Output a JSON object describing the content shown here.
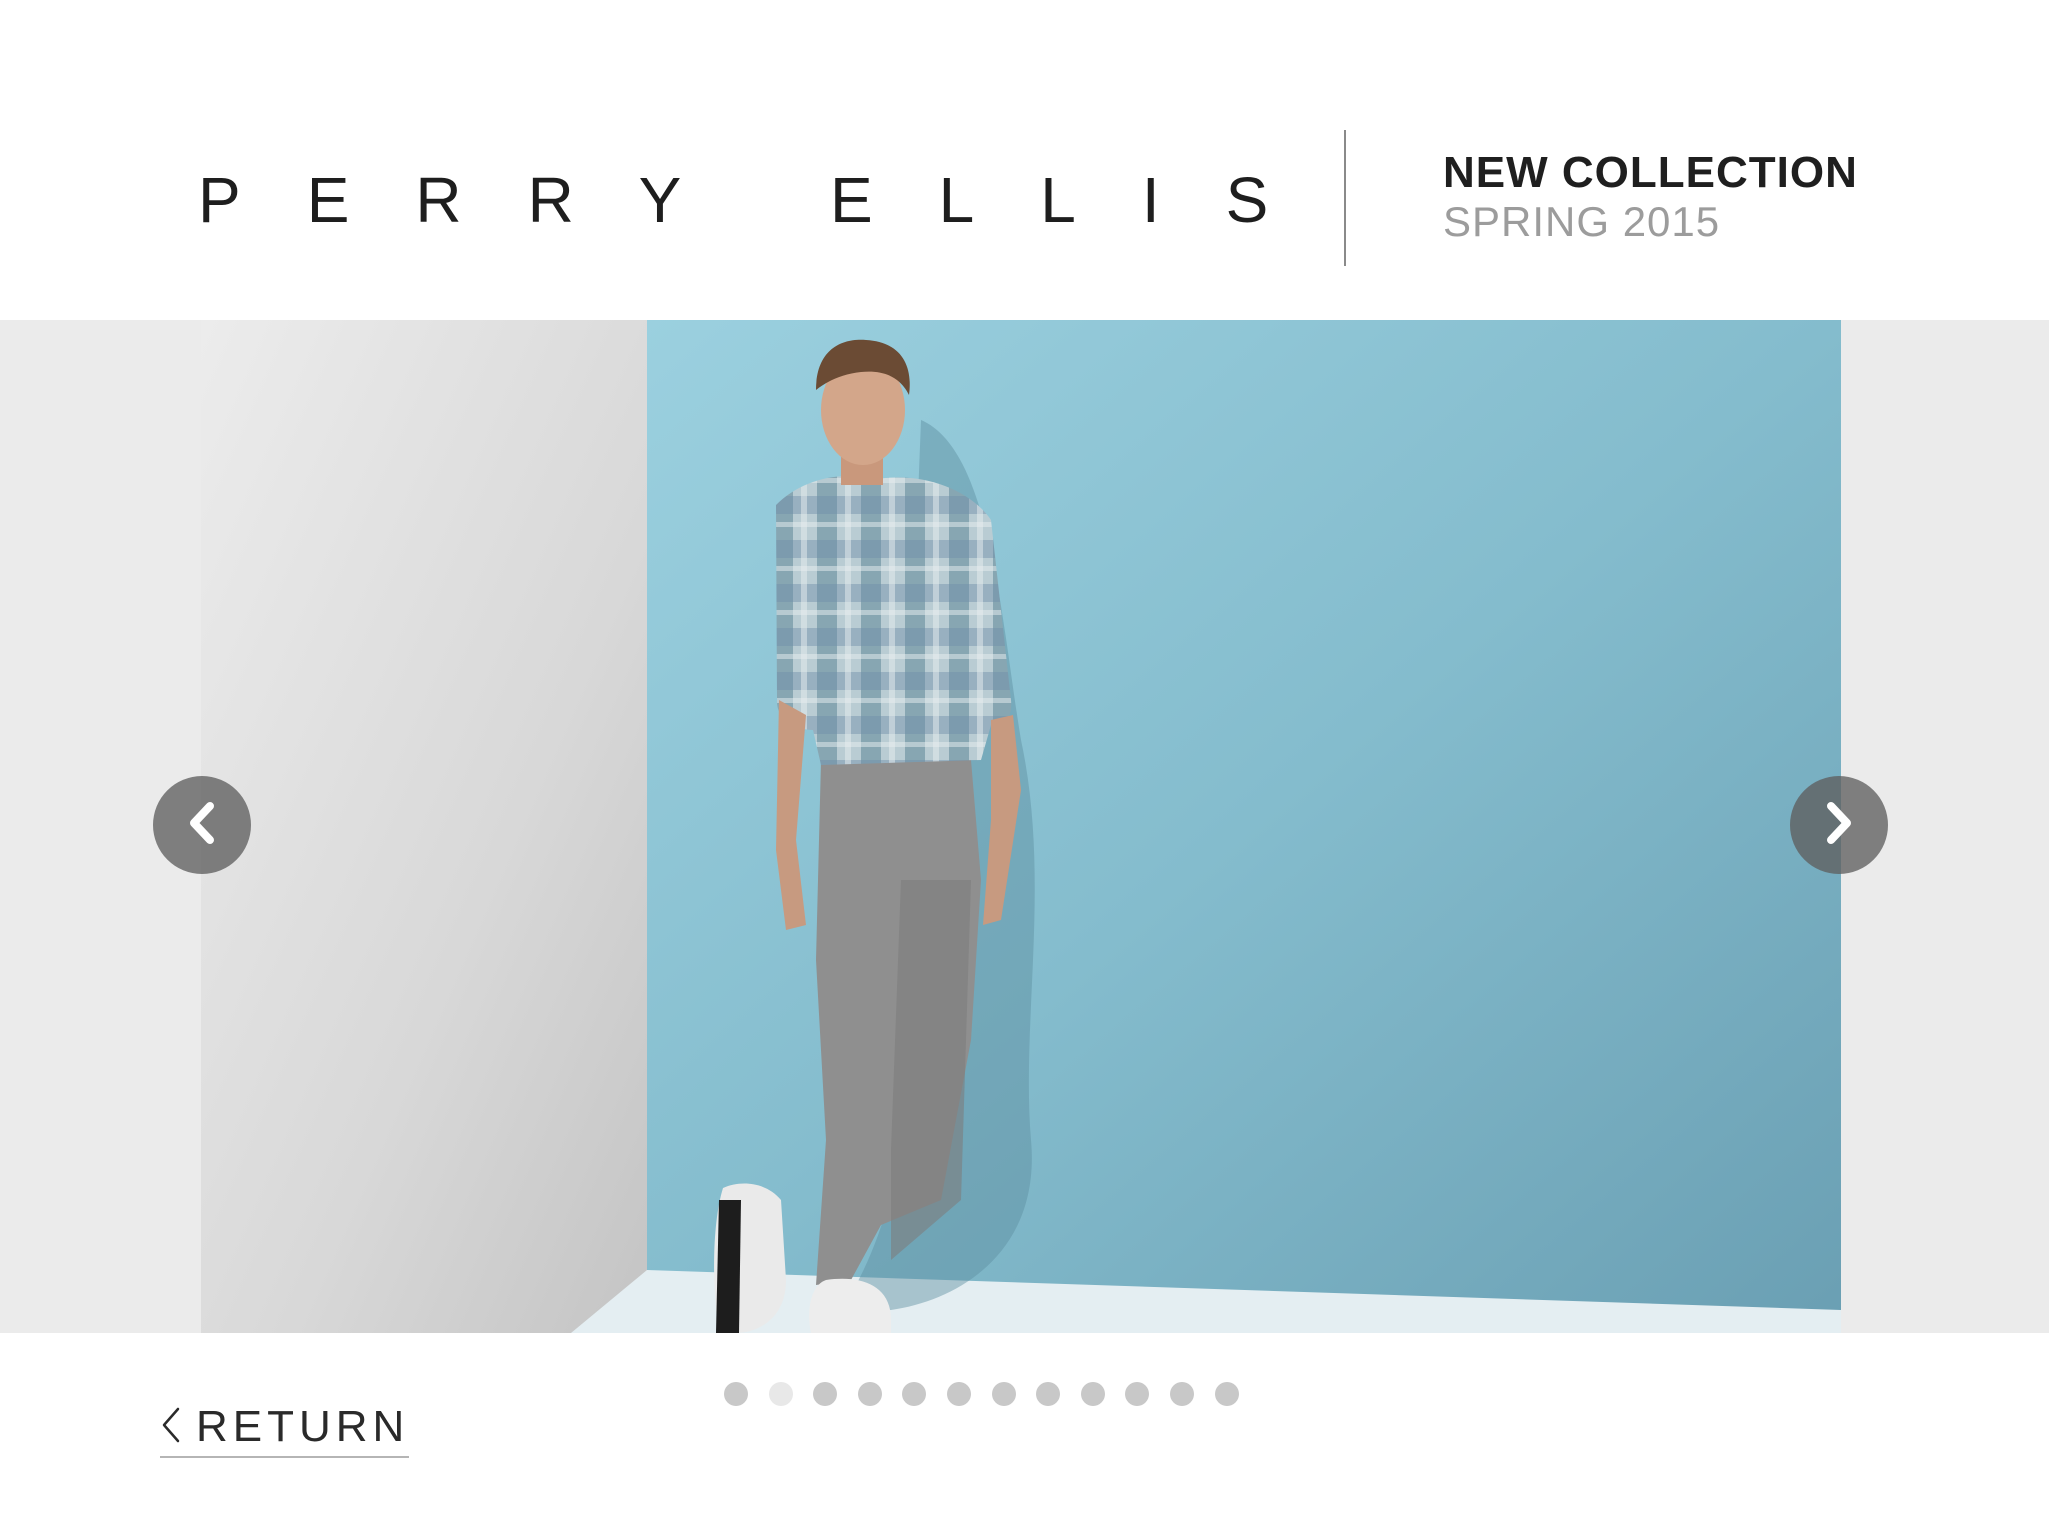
{
  "header": {
    "brand": "PERRY ELLIS",
    "collection_title": "NEW COLLECTION",
    "collection_season": "SPRING 2015"
  },
  "carousel": {
    "prev_icon": "chevron-left-icon",
    "next_icon": "chevron-right-icon",
    "slide_count": 12,
    "active_index": 1
  },
  "footer": {
    "return_label": "RETURN",
    "return_icon": "chevron-left-icon"
  },
  "colors": {
    "backdrop_blue": "#8fc3d4",
    "side_panel": "#ebebeb",
    "nav_button": "#5f5f5f",
    "dot": "#c8c8c8",
    "dot_active": "#e8e8e8"
  }
}
